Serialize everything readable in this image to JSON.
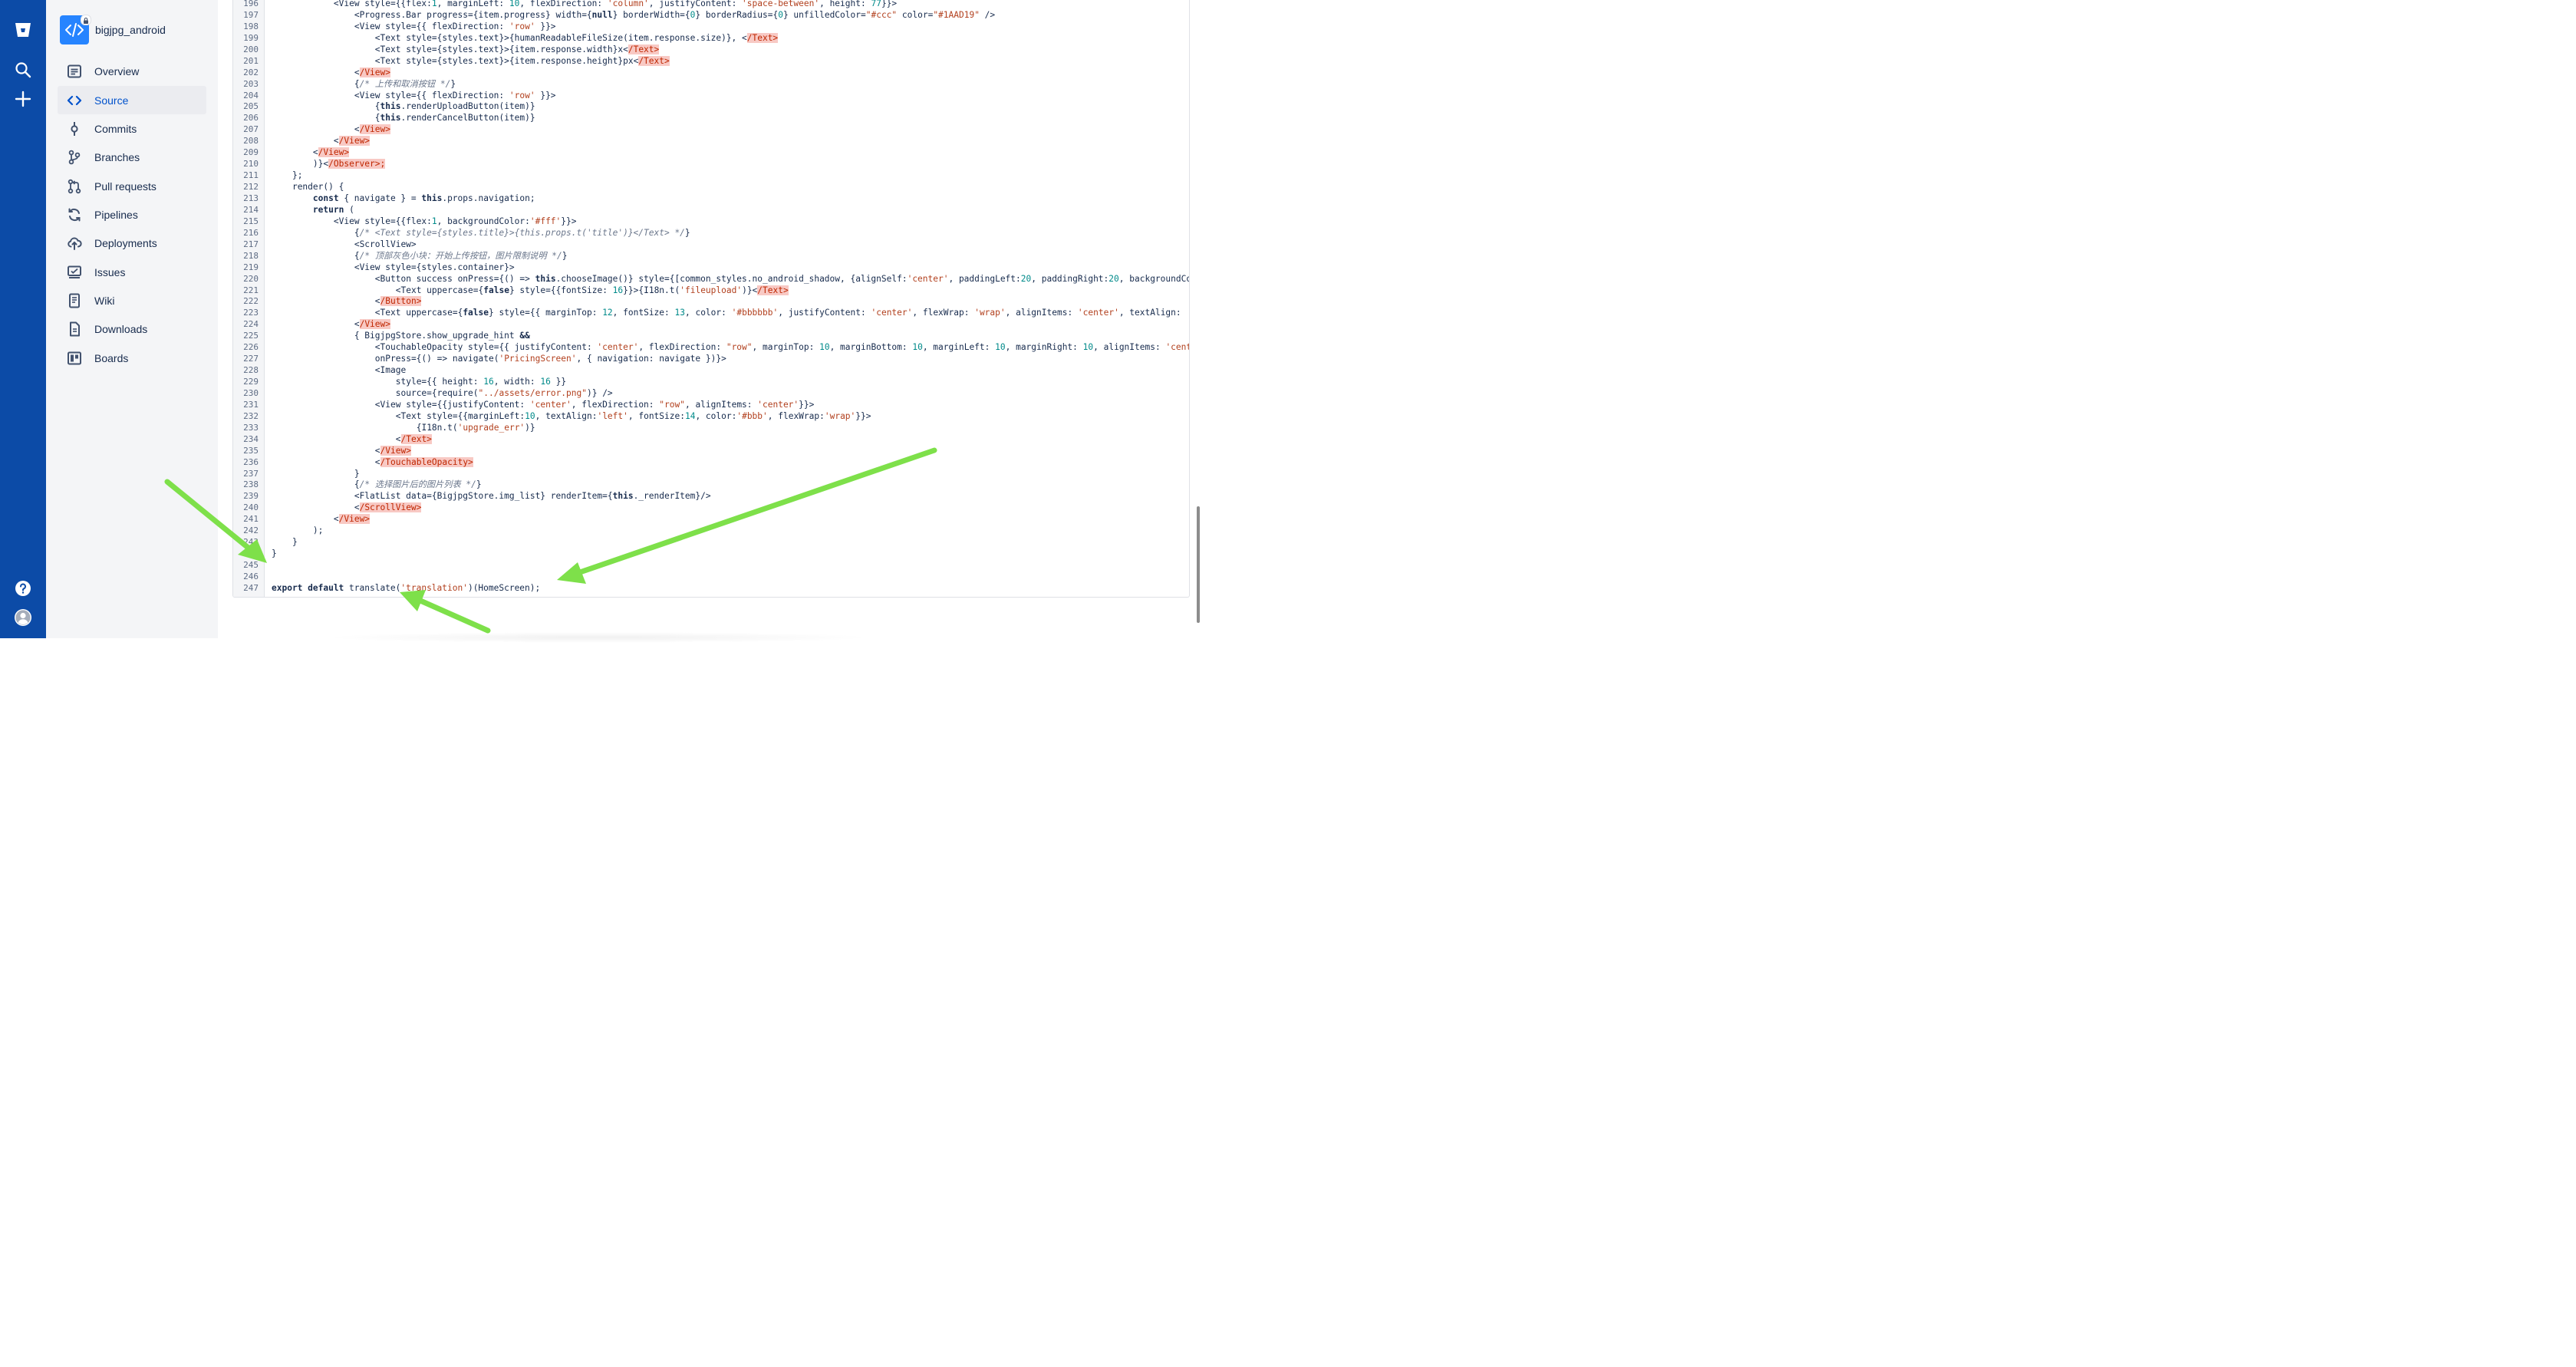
{
  "repo": {
    "name": "bigjpg_android"
  },
  "global_nav": {
    "icons": [
      "bitbucket-logo-icon",
      "search-icon",
      "plus-icon",
      "help-icon",
      "user-avatar-icon"
    ]
  },
  "sidebar": {
    "items": [
      {
        "label": "Overview",
        "icon": "overview-icon",
        "active": false
      },
      {
        "label": "Source",
        "icon": "source-icon",
        "active": true
      },
      {
        "label": "Commits",
        "icon": "commits-icon",
        "active": false
      },
      {
        "label": "Branches",
        "icon": "branches-icon",
        "active": false
      },
      {
        "label": "Pull requests",
        "icon": "pull-requests-icon",
        "active": false
      },
      {
        "label": "Pipelines",
        "icon": "pipelines-icon",
        "active": false
      },
      {
        "label": "Deployments",
        "icon": "deployments-icon",
        "active": false
      },
      {
        "label": "Issues",
        "icon": "issues-icon",
        "active": false
      },
      {
        "label": "Wiki",
        "icon": "wiki-icon",
        "active": false
      },
      {
        "label": "Downloads",
        "icon": "downloads-icon",
        "active": false
      },
      {
        "label": "Boards",
        "icon": "boards-icon",
        "active": false
      }
    ]
  },
  "code": {
    "lines": [
      {
        "n": "196",
        "indent": 12,
        "tokens": [
          [
            "t",
            "<View style={{flex:"
          ],
          [
            "num",
            "1"
          ],
          [
            "t",
            ", marginLeft: "
          ],
          [
            "num",
            "10"
          ],
          [
            "t",
            ", flexDirection: "
          ],
          [
            "str",
            "'column'"
          ],
          [
            "t",
            ", justifyContent: "
          ],
          [
            "str",
            "'space-between'"
          ],
          [
            "t",
            ", height: "
          ],
          [
            "num",
            "77"
          ],
          [
            "t",
            "}}>"
          ]
        ]
      },
      {
        "n": "197",
        "indent": 16,
        "tokens": [
          [
            "t",
            "<Progress.Bar progress={item.progress} width={"
          ],
          [
            "kw",
            "null"
          ],
          [
            "t",
            "} borderWidth={"
          ],
          [
            "num",
            "0"
          ],
          [
            "t",
            "} borderRadius={"
          ],
          [
            "num",
            "0"
          ],
          [
            "t",
            "} unfilledColor="
          ],
          [
            "str",
            "\"#ccc\""
          ],
          [
            "t",
            " color="
          ],
          [
            "str",
            "\"#1AAD19\""
          ],
          [
            "t",
            " />"
          ]
        ]
      },
      {
        "n": "198",
        "indent": 16,
        "tokens": [
          [
            "t",
            "<View style={{ flexDirection: "
          ],
          [
            "str",
            "'row'"
          ],
          [
            "t",
            " }}>"
          ]
        ]
      },
      {
        "n": "199",
        "indent": 20,
        "tokens": [
          [
            "t",
            "<Text style={styles.text}>{humanReadableFileSize(item.response.size)}, <"
          ],
          [
            "err",
            "/Text>"
          ]
        ]
      },
      {
        "n": "200",
        "indent": 20,
        "tokens": [
          [
            "t",
            "<Text style={styles.text}>{item.response.width}x<"
          ],
          [
            "err",
            "/Text>"
          ]
        ]
      },
      {
        "n": "201",
        "indent": 20,
        "tokens": [
          [
            "t",
            "<Text style={styles.text}>{item.response.height}px<"
          ],
          [
            "err",
            "/Text>"
          ]
        ]
      },
      {
        "n": "202",
        "indent": 16,
        "tokens": [
          [
            "t",
            "<"
          ],
          [
            "err",
            "/View>"
          ]
        ]
      },
      {
        "n": "203",
        "indent": 16,
        "tokens": [
          [
            "t",
            "{"
          ],
          [
            "cmt",
            "/* 上传和取消按钮 */"
          ],
          [
            "t",
            "}"
          ]
        ]
      },
      {
        "n": "204",
        "indent": 16,
        "tokens": [
          [
            "t",
            "<View style={{ flexDirection: "
          ],
          [
            "str",
            "'row'"
          ],
          [
            "t",
            " }}>"
          ]
        ]
      },
      {
        "n": "205",
        "indent": 20,
        "tokens": [
          [
            "t",
            "{"
          ],
          [
            "kw",
            "this"
          ],
          [
            "t",
            ".renderUploadButton(item)}"
          ]
        ]
      },
      {
        "n": "206",
        "indent": 20,
        "tokens": [
          [
            "t",
            "{"
          ],
          [
            "kw",
            "this"
          ],
          [
            "t",
            ".renderCancelButton(item)}"
          ]
        ]
      },
      {
        "n": "207",
        "indent": 16,
        "tokens": [
          [
            "t",
            "<"
          ],
          [
            "err",
            "/View>"
          ]
        ]
      },
      {
        "n": "208",
        "indent": 12,
        "tokens": [
          [
            "t",
            "<"
          ],
          [
            "err",
            "/View>"
          ]
        ]
      },
      {
        "n": "209",
        "indent": 8,
        "tokens": [
          [
            "t",
            "<"
          ],
          [
            "err",
            "/View>"
          ]
        ]
      },
      {
        "n": "210",
        "indent": 8,
        "tokens": [
          [
            "t",
            ")}<"
          ],
          [
            "err",
            "/Observer>;"
          ]
        ]
      },
      {
        "n": "211",
        "indent": 4,
        "tokens": [
          [
            "t",
            "};"
          ]
        ]
      },
      {
        "n": "212",
        "indent": 4,
        "tokens": [
          [
            "t",
            "render() {"
          ]
        ]
      },
      {
        "n": "213",
        "indent": 8,
        "tokens": [
          [
            "kw",
            "const"
          ],
          [
            "t",
            " { navigate } = "
          ],
          [
            "kw",
            "this"
          ],
          [
            "t",
            ".props.navigation;"
          ]
        ]
      },
      {
        "n": "214",
        "indent": 8,
        "tokens": [
          [
            "kw",
            "return"
          ],
          [
            "t",
            " ("
          ]
        ]
      },
      {
        "n": "215",
        "indent": 12,
        "tokens": [
          [
            "t",
            "<View style={{flex:"
          ],
          [
            "num",
            "1"
          ],
          [
            "t",
            ", backgroundColor:"
          ],
          [
            "str",
            "'#fff'"
          ],
          [
            "t",
            "}}>"
          ]
        ]
      },
      {
        "n": "216",
        "indent": 16,
        "tokens": [
          [
            "t",
            "{"
          ],
          [
            "cmt",
            "/* <Text style={styles.title}>{this.props.t('title')}</Text> */"
          ],
          [
            "t",
            "}"
          ]
        ]
      },
      {
        "n": "217",
        "indent": 16,
        "tokens": [
          [
            "t",
            "<ScrollView>"
          ]
        ]
      },
      {
        "n": "218",
        "indent": 16,
        "tokens": [
          [
            "t",
            "{"
          ],
          [
            "cmt",
            "/* 顶部灰色小块：开始上传按钮，图片限制说明 */"
          ],
          [
            "t",
            "}"
          ]
        ]
      },
      {
        "n": "219",
        "indent": 16,
        "tokens": [
          [
            "t",
            "<View style={styles.container}>"
          ]
        ]
      },
      {
        "n": "220",
        "indent": 20,
        "tokens": [
          [
            "t",
            "<Button success onPress={() => "
          ],
          [
            "kw",
            "this"
          ],
          [
            "t",
            ".chooseImage()} style={[common_styles.no_android_shadow, {alignSelf:"
          ],
          [
            "str",
            "'center'"
          ],
          [
            "t",
            ", paddingLeft:"
          ],
          [
            "num",
            "20"
          ],
          [
            "t",
            ", paddingRight:"
          ],
          [
            "num",
            "20"
          ],
          [
            "t",
            ", backgroundColor"
          ]
        ]
      },
      {
        "n": "221",
        "indent": 24,
        "tokens": [
          [
            "t",
            "<Text uppercase={"
          ],
          [
            "kw",
            "false"
          ],
          [
            "t",
            "} style={{fontSize: "
          ],
          [
            "num",
            "16"
          ],
          [
            "t",
            "}}>{I18n.t("
          ],
          [
            "str",
            "'fileupload'"
          ],
          [
            "t",
            ")}<"
          ],
          [
            "err",
            "/Text>"
          ]
        ]
      },
      {
        "n": "222",
        "indent": 20,
        "tokens": [
          [
            "t",
            "<"
          ],
          [
            "err",
            "/Button>"
          ]
        ]
      },
      {
        "n": "223",
        "indent": 20,
        "tokens": [
          [
            "t",
            "<Text uppercase={"
          ],
          [
            "kw",
            "false"
          ],
          [
            "t",
            "} style={{ marginTop: "
          ],
          [
            "num",
            "12"
          ],
          [
            "t",
            ", fontSize: "
          ],
          [
            "num",
            "13"
          ],
          [
            "t",
            ", color: "
          ],
          [
            "str",
            "'#bbbbbb'"
          ],
          [
            "t",
            ", justifyContent: "
          ],
          [
            "str",
            "'center'"
          ],
          [
            "t",
            ", flexWrap: "
          ],
          [
            "str",
            "'wrap'"
          ],
          [
            "t",
            ", alignItems: "
          ],
          [
            "str",
            "'center'"
          ],
          [
            "t",
            ", textAlign: "
          ]
        ]
      },
      {
        "n": "224",
        "indent": 16,
        "tokens": [
          [
            "t",
            "<"
          ],
          [
            "err",
            "/View>"
          ]
        ]
      },
      {
        "n": "225",
        "indent": 16,
        "tokens": [
          [
            "t",
            "{ BigjpgStore.show_upgrade_hint "
          ],
          [
            "kw",
            "&&"
          ]
        ]
      },
      {
        "n": "226",
        "indent": 20,
        "tokens": [
          [
            "t",
            "<TouchableOpacity style={{ justifyContent: "
          ],
          [
            "str",
            "'center'"
          ],
          [
            "t",
            ", flexDirection: "
          ],
          [
            "str",
            "\"row\""
          ],
          [
            "t",
            ", marginTop: "
          ],
          [
            "num",
            "10"
          ],
          [
            "t",
            ", marginBottom: "
          ],
          [
            "num",
            "10"
          ],
          [
            "t",
            ", marginLeft: "
          ],
          [
            "num",
            "10"
          ],
          [
            "t",
            ", marginRight: "
          ],
          [
            "num",
            "10"
          ],
          [
            "t",
            ", alignItems: "
          ],
          [
            "str",
            "'center'"
          ]
        ]
      },
      {
        "n": "227",
        "indent": 20,
        "tokens": [
          [
            "t",
            "onPress={() => navigate("
          ],
          [
            "str",
            "'PricingScreen'"
          ],
          [
            "t",
            ", { navigation: navigate })}>"
          ]
        ]
      },
      {
        "n": "228",
        "indent": 20,
        "tokens": [
          [
            "t",
            "<Image"
          ]
        ]
      },
      {
        "n": "229",
        "indent": 24,
        "tokens": [
          [
            "t",
            "style={{ height: "
          ],
          [
            "num",
            "16"
          ],
          [
            "t",
            ", width: "
          ],
          [
            "num",
            "16"
          ],
          [
            "t",
            " }}"
          ]
        ]
      },
      {
        "n": "230",
        "indent": 24,
        "tokens": [
          [
            "t",
            "source={require("
          ],
          [
            "str",
            "\"../assets/error.png\""
          ],
          [
            "t",
            ")} />"
          ]
        ]
      },
      {
        "n": "231",
        "indent": 20,
        "tokens": [
          [
            "t",
            "<View style={{justifyContent: "
          ],
          [
            "str",
            "'center'"
          ],
          [
            "t",
            ", flexDirection: "
          ],
          [
            "str",
            "\"row\""
          ],
          [
            "t",
            ", alignItems: "
          ],
          [
            "str",
            "'center'"
          ],
          [
            "t",
            "}}>"
          ]
        ]
      },
      {
        "n": "232",
        "indent": 24,
        "tokens": [
          [
            "t",
            "<Text style={{marginLeft:"
          ],
          [
            "num",
            "10"
          ],
          [
            "t",
            ", textAlign:"
          ],
          [
            "str",
            "'left'"
          ],
          [
            "t",
            ", fontSize:"
          ],
          [
            "num",
            "14"
          ],
          [
            "t",
            ", color:"
          ],
          [
            "str",
            "'#bbb'"
          ],
          [
            "t",
            ", flexWrap:"
          ],
          [
            "str",
            "'wrap'"
          ],
          [
            "t",
            "}}>"
          ]
        ]
      },
      {
        "n": "233",
        "indent": 28,
        "tokens": [
          [
            "t",
            "{I18n.t("
          ],
          [
            "str",
            "'upgrade_err'"
          ],
          [
            "t",
            ")}"
          ]
        ]
      },
      {
        "n": "234",
        "indent": 24,
        "tokens": [
          [
            "t",
            "<"
          ],
          [
            "err",
            "/Text>"
          ]
        ]
      },
      {
        "n": "235",
        "indent": 20,
        "tokens": [
          [
            "t",
            "<"
          ],
          [
            "err",
            "/View>"
          ]
        ]
      },
      {
        "n": "236",
        "indent": 20,
        "tokens": [
          [
            "t",
            "<"
          ],
          [
            "err",
            "/TouchableOpacity>"
          ]
        ]
      },
      {
        "n": "237",
        "indent": 16,
        "tokens": [
          [
            "t",
            "}"
          ]
        ]
      },
      {
        "n": "238",
        "indent": 16,
        "tokens": [
          [
            "t",
            "{"
          ],
          [
            "cmt",
            "/* 选择图片后的图片列表 */"
          ],
          [
            "t",
            "}"
          ]
        ]
      },
      {
        "n": "239",
        "indent": 16,
        "tokens": [
          [
            "t",
            "<FlatList data={BigjpgStore.img_list} renderItem={"
          ],
          [
            "kw",
            "this"
          ],
          [
            "t",
            "._renderItem}/>"
          ]
        ]
      },
      {
        "n": "240",
        "indent": 16,
        "tokens": [
          [
            "t",
            "<"
          ],
          [
            "err",
            "/ScrollView>"
          ]
        ]
      },
      {
        "n": "241",
        "indent": 12,
        "tokens": [
          [
            "t",
            "<"
          ],
          [
            "err",
            "/View>"
          ]
        ]
      },
      {
        "n": "242",
        "indent": 8,
        "tokens": [
          [
            "t",
            ");"
          ]
        ]
      },
      {
        "n": "243",
        "indent": 4,
        "tokens": [
          [
            "t",
            "}"
          ]
        ]
      },
      {
        "n": "244",
        "indent": 0,
        "tokens": [
          [
            "t",
            "}"
          ]
        ]
      },
      {
        "n": "245",
        "indent": 0,
        "tokens": []
      },
      {
        "n": "246",
        "indent": 0,
        "tokens": []
      },
      {
        "n": "247",
        "indent": 0,
        "tokens": [
          [
            "kw",
            "export default"
          ],
          [
            "t",
            " translate("
          ],
          [
            "str",
            "'translation'"
          ],
          [
            "t",
            ")(HomeScreen);"
          ]
        ]
      }
    ]
  },
  "annotations": {
    "arrow_color": "#7ee04a",
    "arrows": 3
  }
}
